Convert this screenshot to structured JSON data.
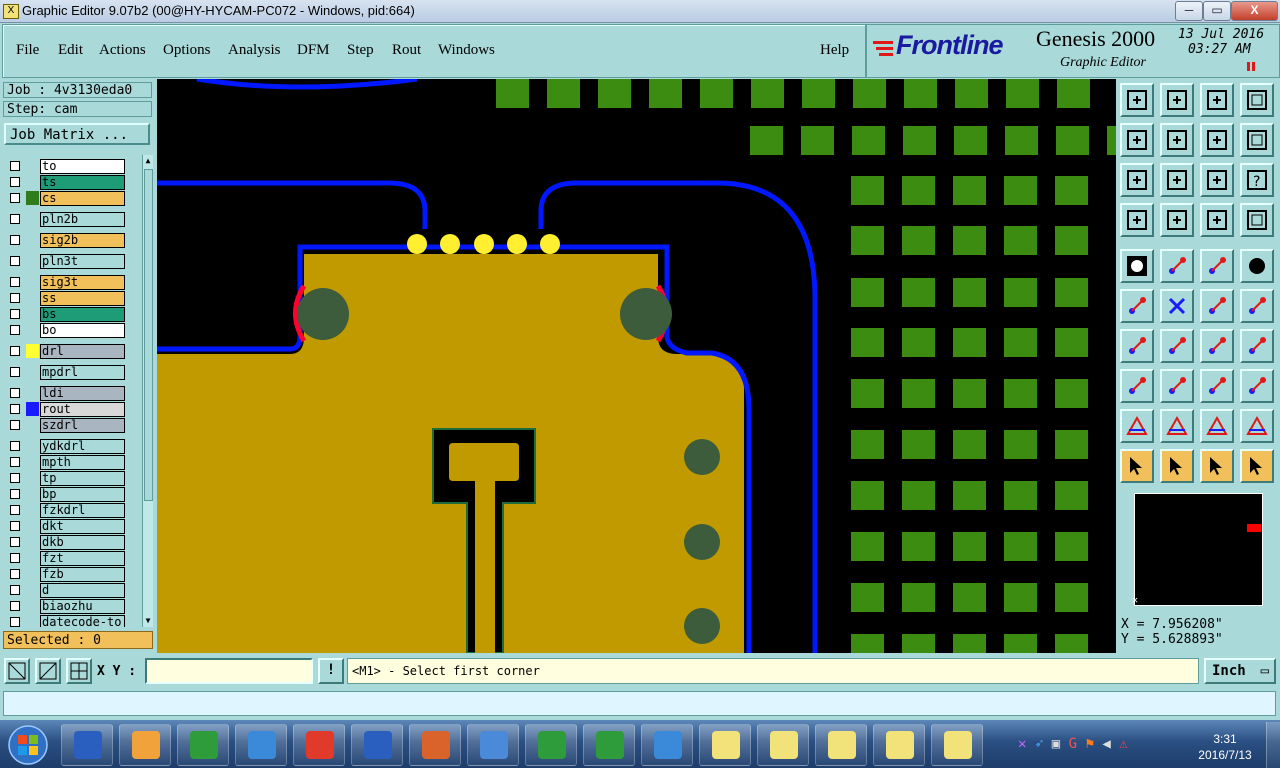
{
  "window": {
    "title": "Graphic Editor 9.07b2 (00@HY-HYCAM-PC072 - Windows, pid:664)",
    "app_icon_glyph": "X",
    "minimize_label": "─",
    "restore_label": "▭",
    "close_label": "X"
  },
  "menu": {
    "items": [
      "File",
      "Edit",
      "Actions",
      "Options",
      "Analysis",
      "DFM",
      "Step",
      "Rout",
      "Windows"
    ],
    "help": "Help"
  },
  "branding": {
    "logo": "Frontline",
    "product": "Genesis 2000",
    "subtitle": "Graphic Editor",
    "date": "13 Jul 2016",
    "time": "03:27 AM"
  },
  "left_panel": {
    "job": "Job : 4v3130eda0",
    "step": "Step: cam",
    "job_matrix_button": "Job Matrix ...",
    "selected": "Selected : 0"
  },
  "layers": [
    {
      "name": "to",
      "color": "#ffffff",
      "swatch": "",
      "cursor": true
    },
    {
      "name": "ts",
      "color": "#1e9c78",
      "swatch": ""
    },
    {
      "name": "cs",
      "color": "#f2c05a",
      "swatch": "#2e7d1a"
    },
    {
      "name": "pln2b",
      "color": "#a9d9d9",
      "swatch": ""
    },
    {
      "name": "sig2b",
      "color": "#f2c05a",
      "swatch": ""
    },
    {
      "name": "pln3t",
      "color": "#a9d9d9",
      "swatch": ""
    },
    {
      "name": "sig3t",
      "color": "#f2c05a",
      "swatch": "",
      "cursor": true
    },
    {
      "name": "ss",
      "color": "#f2c05a",
      "swatch": ""
    },
    {
      "name": "bs",
      "color": "#1e9c78",
      "swatch": ""
    },
    {
      "name": "bo",
      "color": "#ffffff",
      "swatch": ""
    },
    {
      "name": "drl",
      "color": "#a9b5c0",
      "swatch": "#ffff33"
    },
    {
      "name": "mpdrl",
      "color": "#a9d9d9",
      "swatch": ""
    },
    {
      "name": "ldi",
      "color": "#a9b5c0",
      "swatch": ""
    },
    {
      "name": "rout",
      "color": "#d8d8d8",
      "swatch": "#1a1aff"
    },
    {
      "name": "szdrl",
      "color": "#a9b5c0",
      "swatch": ""
    },
    {
      "name": "ydkdrl",
      "color": "#a9d9d9",
      "swatch": ""
    },
    {
      "name": "mpth",
      "color": "#a9d9d9",
      "swatch": ""
    },
    {
      "name": "tp",
      "color": "#a9d9d9",
      "swatch": ""
    },
    {
      "name": "bp",
      "color": "#a9d9d9",
      "swatch": ""
    },
    {
      "name": "fzkdrl",
      "color": "#a9d9d9",
      "swatch": ""
    },
    {
      "name": "dkt",
      "color": "#a9d9d9",
      "swatch": ""
    },
    {
      "name": "dkb",
      "color": "#a9d9d9",
      "swatch": ""
    },
    {
      "name": "fzt",
      "color": "#a9d9d9",
      "swatch": ""
    },
    {
      "name": "fzb",
      "color": "#a9d9d9",
      "swatch": ""
    },
    {
      "name": "d",
      "color": "#a9d9d9",
      "swatch": ""
    },
    {
      "name": "biaozhu",
      "color": "#a9d9d9",
      "swatch": ""
    },
    {
      "name": "datecode-to",
      "color": "#a9d9d9",
      "swatch": ""
    }
  ],
  "coords": {
    "x": "X = 7.956208\"",
    "y": "Y = 5.628893\""
  },
  "status": {
    "xy_label": "X Y :",
    "xy_value": "",
    "warn_label": "!",
    "prompt": "<M1> - Select first corner",
    "units": "Inch",
    "message": ""
  },
  "tools": [
    "send-to-layer-icon",
    "load-layer-icon",
    "home-icon",
    "frame-icon",
    "pan-left-icon",
    "pan-right-icon",
    "undo-icon",
    "redo-icon",
    "zoom-fit-icon",
    "zoom-center-icon",
    "zoom-one-to-one-icon",
    "help-icon",
    "measure-icon",
    "grid-icon",
    "net-icon",
    "net-select-icon",
    "pad-icon",
    "polygon-icon",
    "ruler-icon",
    "dot-icon",
    "line-connect-icon",
    "cross-icon",
    "arc-connect-icon",
    "arc-pad-icon",
    "angle-icon",
    "slash-icon",
    "arc-icon",
    "flip-icon",
    "snap-icon",
    "minus-icon",
    "dimension-icon",
    "shape-icon",
    "triangle-icon",
    "triangle-a-icon",
    "triangle-b-icon",
    "triangle-c-icon",
    "pointer-icon",
    "pointer-box-icon",
    "pointer-circle-icon",
    "pointer-path-icon"
  ],
  "taskbar": {
    "clock_time": "3:31",
    "clock_date": "2016/7/13"
  }
}
